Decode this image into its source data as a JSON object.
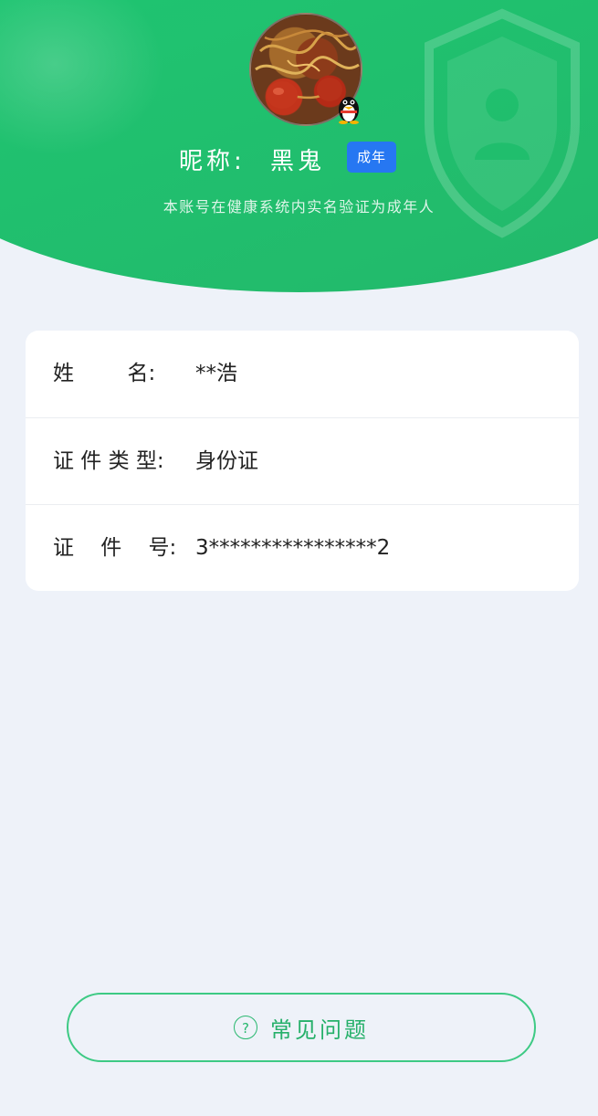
{
  "header": {
    "nickname_label": "昵称:",
    "nickname": "黑鬼",
    "age_badge": "成年",
    "verify_note": "本账号在健康系统内实名验证为成年人"
  },
  "identity": {
    "rows": [
      {
        "label": "姓        名:",
        "value": "**浩"
      },
      {
        "label": "证 件 类 型:",
        "value": "身份证"
      },
      {
        "label": "证    件    号:",
        "value": "3****************2"
      }
    ]
  },
  "footer": {
    "faq_icon": "?",
    "faq_label": "常见问题"
  },
  "icons": {
    "avatar": "avatar-food-photo",
    "qq_badge": "qq-penguin-icon",
    "shield": "shield-watermark-icon",
    "faq": "question-circle-icon"
  },
  "colors": {
    "header_green": "#1ec672",
    "badge_blue": "#2677f2",
    "accent_green": "#26b06a",
    "page_bg": "#eef2f9"
  }
}
